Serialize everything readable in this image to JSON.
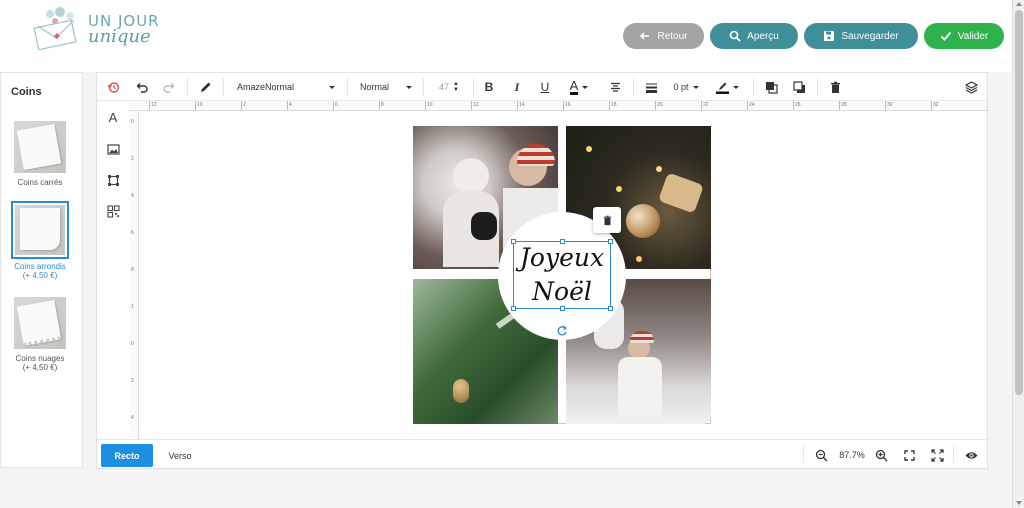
{
  "brand": {
    "line1": "UN JOUR",
    "line2": "unique"
  },
  "header": {
    "back_label": "Retour",
    "preview_label": "Aperçu",
    "save_label": "Sauvegarder",
    "validate_label": "Valider"
  },
  "colors": {
    "back": "#a3a3a3",
    "preview": "#3f8f98",
    "save": "#3f8f98",
    "validate": "#2fb24c",
    "accent": "#1e8fe0"
  },
  "corners": {
    "title": "Coins",
    "options": [
      {
        "label": "Coins carrés",
        "price": ""
      },
      {
        "label": "Coins arrondis",
        "price": "(+ 4,50 €)"
      },
      {
        "label": "Coins nuages",
        "price": "(+ 4,50 €)"
      }
    ],
    "selected": "Coins arrondis"
  },
  "toolbar": {
    "font": "AmazeNormal",
    "style": "Normal",
    "size": "47",
    "stroke": "0 pt"
  },
  "ruler_h": [
    "12",
    "10",
    "2",
    "4",
    "6",
    "8",
    "10",
    "12",
    "14",
    "16",
    "18",
    "20",
    "22",
    "24",
    "26",
    "28",
    "30",
    "32"
  ],
  "ruler_v": [
    "0",
    "2",
    "4",
    "6",
    "8",
    "1",
    "0",
    "2",
    "4"
  ],
  "card": {
    "text_line1": "Joyeux",
    "text_line2": "Noël"
  },
  "bottom": {
    "tab_recto": "Recto",
    "tab_verso": "Verso",
    "zoom": "87.7%"
  },
  "icons": [
    "history-icon",
    "undo-icon",
    "redo-icon",
    "pen-icon",
    "bold-icon",
    "italic-icon",
    "underline-icon",
    "text-color-icon",
    "align-icon",
    "line-weight-icon",
    "stroke-color-icon",
    "bring-front-icon",
    "send-back-icon",
    "delete-icon",
    "layers-icon",
    "text-tool-icon",
    "image-tool-icon",
    "shape-tool-icon",
    "qr-tool-icon",
    "zoom-out-icon",
    "zoom-in-icon",
    "fit-icon",
    "fullscreen-icon",
    "eye-icon"
  ]
}
